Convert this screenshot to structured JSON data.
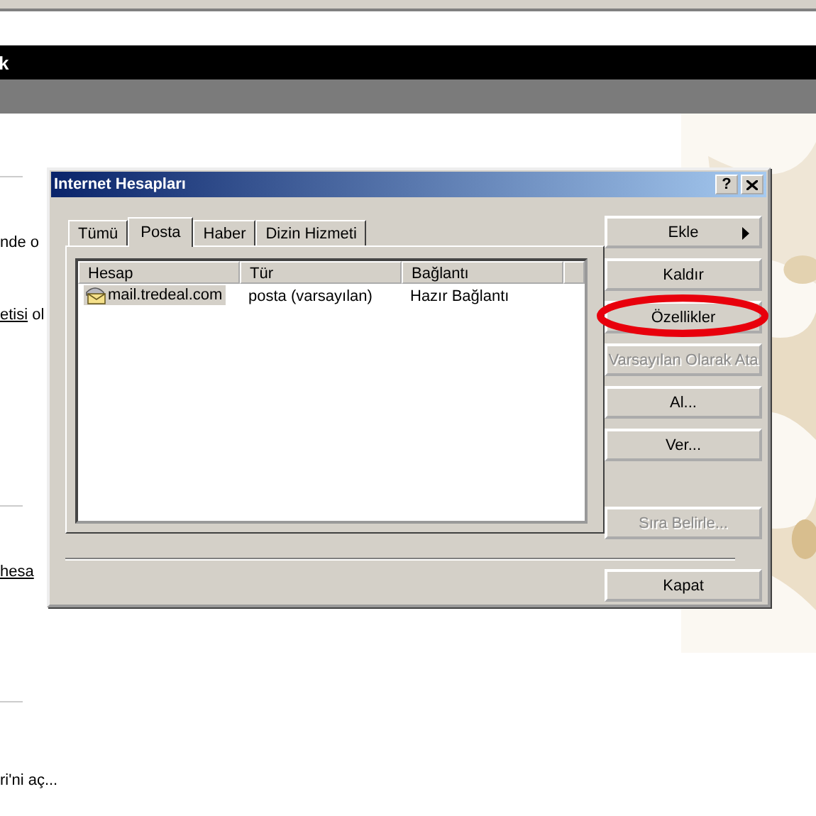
{
  "page": {
    "header_text": "k",
    "items": [
      {
        "kind": "rule"
      },
      {
        "kind": "text",
        "text": "nde o"
      },
      {
        "kind": "link_text",
        "link": "etisi",
        "text": "ol"
      },
      {
        "kind": "rule"
      },
      {
        "kind": "link",
        "link": "hesa"
      },
      {
        "kind": "rule"
      },
      {
        "kind": "text",
        "text": "ri'ni aç..."
      }
    ]
  },
  "dialog": {
    "title": "Internet Hesapları",
    "help": "?",
    "tabs": [
      {
        "label": "Tümü",
        "selected": false
      },
      {
        "label": "Posta",
        "selected": true
      },
      {
        "label": "Haber",
        "selected": false
      },
      {
        "label": "Dizin Hizmeti",
        "selected": false
      }
    ],
    "columns": [
      "Hesap",
      "Tür",
      "Bağlantı"
    ],
    "rows": [
      {
        "account": "mail.tredeal.com",
        "type": "posta (varsayılan)",
        "connection": "Hazır Bağlantı",
        "selected": true
      }
    ],
    "buttons": [
      {
        "label": "Ekle",
        "kind": "menu",
        "disabled": false,
        "highlighted": false
      },
      {
        "label": "Kaldır",
        "kind": "push",
        "disabled": false,
        "highlighted": false
      },
      {
        "label": "Özellikler",
        "kind": "push",
        "disabled": false,
        "highlighted": true
      },
      {
        "label": "Varsayılan Olarak Ata",
        "kind": "push",
        "disabled": true,
        "highlighted": false
      },
      {
        "label": "Al...",
        "kind": "push",
        "disabled": false,
        "highlighted": false
      },
      {
        "label": "Ver...",
        "kind": "push",
        "disabled": false,
        "highlighted": false
      },
      {
        "label": "Sıra Belirle...",
        "kind": "push",
        "disabled": true,
        "highlighted": false
      }
    ],
    "close_button": "Kapat"
  }
}
